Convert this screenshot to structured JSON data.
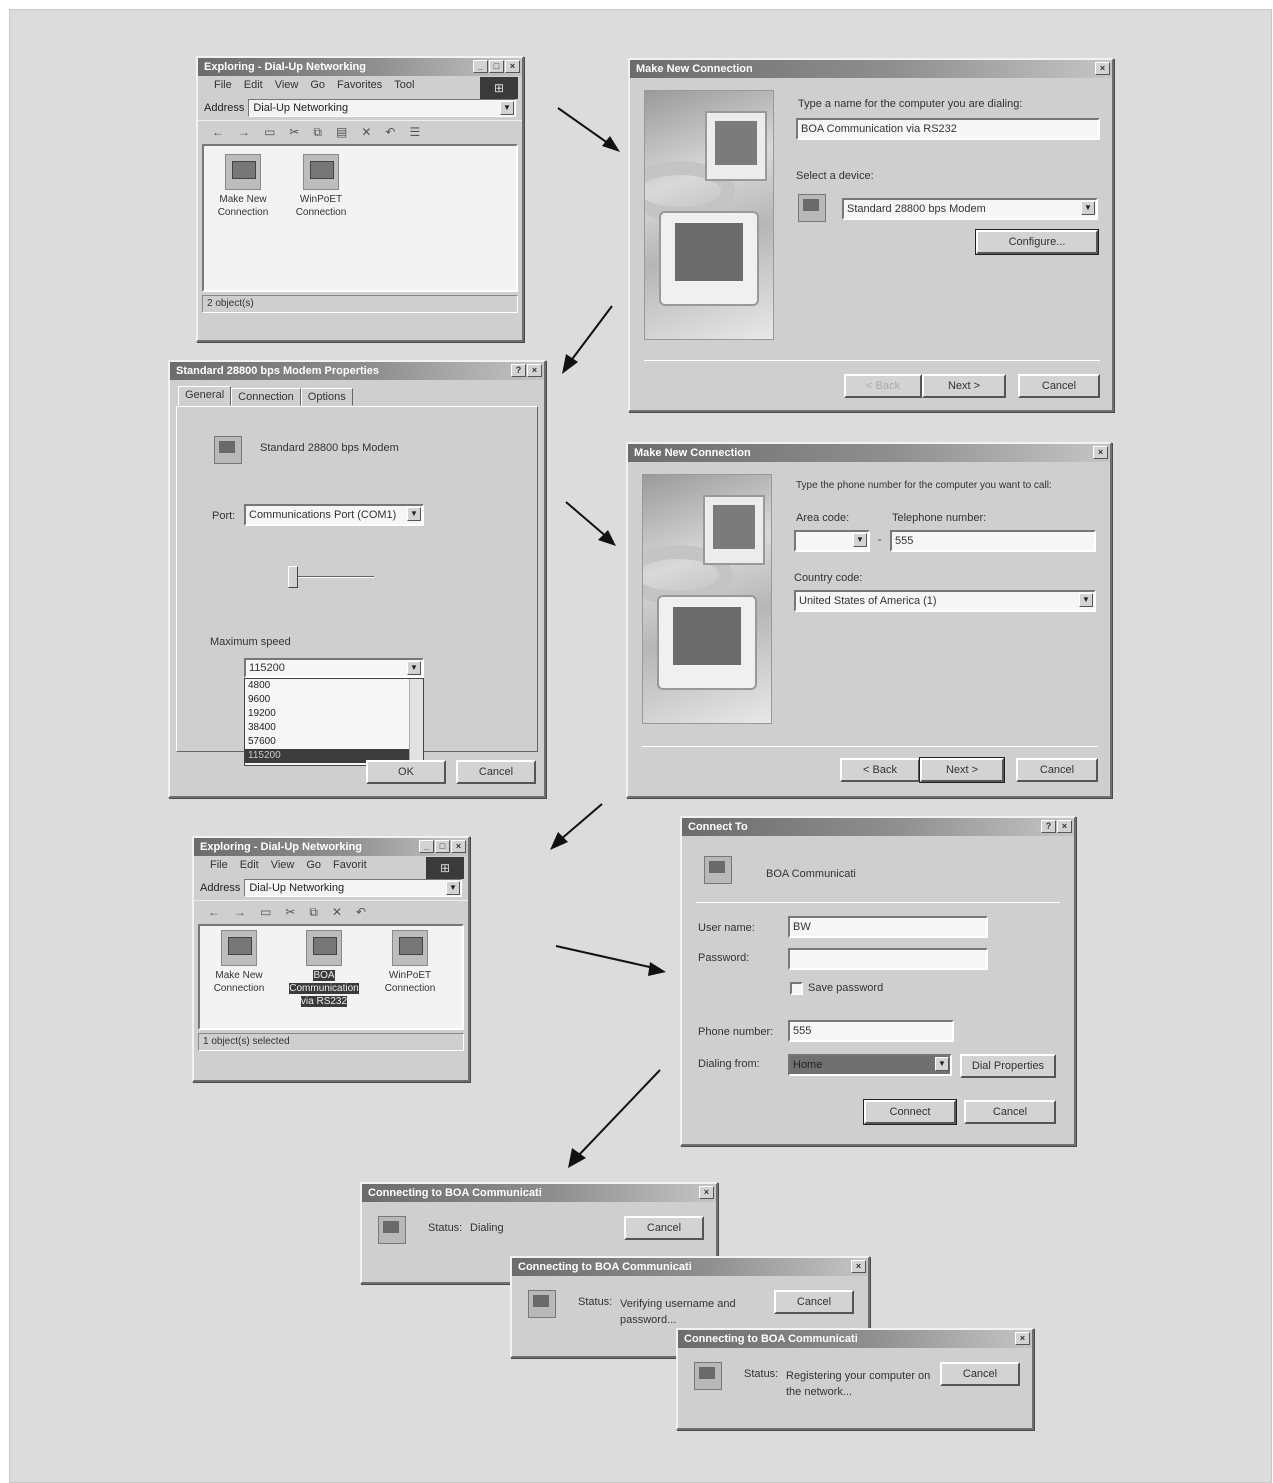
{
  "win1": {
    "title": "Exploring - Dial-Up Networking",
    "menu": [
      "File",
      "Edit",
      "View",
      "Go",
      "Favorites",
      "Tool"
    ],
    "address_label": "Address",
    "address_value": "Dial-Up Networking",
    "icons": [
      {
        "label": "Make New Connection"
      },
      {
        "label": "WinPoET Connection"
      }
    ],
    "status": "2 object(s)"
  },
  "win2": {
    "title": "Make New Connection",
    "name_label": "Type a name for the computer you are dialing:",
    "name_value": "BOA Communication via RS232",
    "device_label": "Select a device:",
    "device_value": "Standard 28800 bps Modem",
    "configure_button": "Configure...",
    "back_button": "< Back",
    "next_button": "Next >",
    "cancel_button": "Cancel"
  },
  "win3": {
    "title": "Standard 28800 bps Modem Properties",
    "tabs": [
      "General",
      "Connection",
      "Options"
    ],
    "modem_name": "Standard 28800 bps Modem",
    "port_label": "Port:",
    "port_value": "Communications Port (COM1)",
    "speed_label": "Maximum speed",
    "speed_value": "115200",
    "speed_options": [
      "4800",
      "9600",
      "19200",
      "38400",
      "57600",
      "115200"
    ],
    "ok_button": "OK",
    "cancel_button": "Cancel"
  },
  "win4": {
    "title": "Make New Connection",
    "phone_prompt": "Type the phone number for the computer you want to call:",
    "area_label": "Area code:",
    "area_value": "",
    "tel_label": "Telephone number:",
    "tel_value": "555",
    "country_label": "Country code:",
    "country_value": "United States of America (1)",
    "back_button": "< Back",
    "next_button": "Next >",
    "cancel_button": "Cancel"
  },
  "win5": {
    "title": "Exploring - Dial-Up Networking",
    "menu": [
      "File",
      "Edit",
      "View",
      "Go",
      "Favorit"
    ],
    "address_label": "Address",
    "address_value": "Dial-Up Networking",
    "icons": [
      {
        "label": "Make New Connection"
      },
      {
        "label": "BOA Communication via RS232"
      },
      {
        "label": "WinPoET Connection"
      }
    ],
    "status": "1 object(s) selected"
  },
  "win6": {
    "title": "Connect To",
    "conn_name": "BOA Communicati",
    "user_label": "User name:",
    "user_value": "BW",
    "password_label": "Password:",
    "password_value": "",
    "save_password_label": "Save password",
    "phone_label": "Phone number:",
    "phone_value": "555",
    "dialing_label": "Dialing from:",
    "dialing_value": "Home",
    "dial_properties_button": "Dial Properties",
    "connect_button": "Connect",
    "cancel_button": "Cancel"
  },
  "status_windows": [
    {
      "title": "Connecting to BOA Communicati",
      "status_label": "Status:",
      "status_text": "Dialing",
      "cancel_button": "Cancel"
    },
    {
      "title": "Connecting to BOA Communicati",
      "status_label": "Status:",
      "status_text": "Verifying username and password...",
      "cancel_button": "Cancel"
    },
    {
      "title": "Connecting to BOA Communicati",
      "status_label": "Status:",
      "status_text": "Registering your computer on the network...",
      "cancel_button": "Cancel"
    }
  ]
}
